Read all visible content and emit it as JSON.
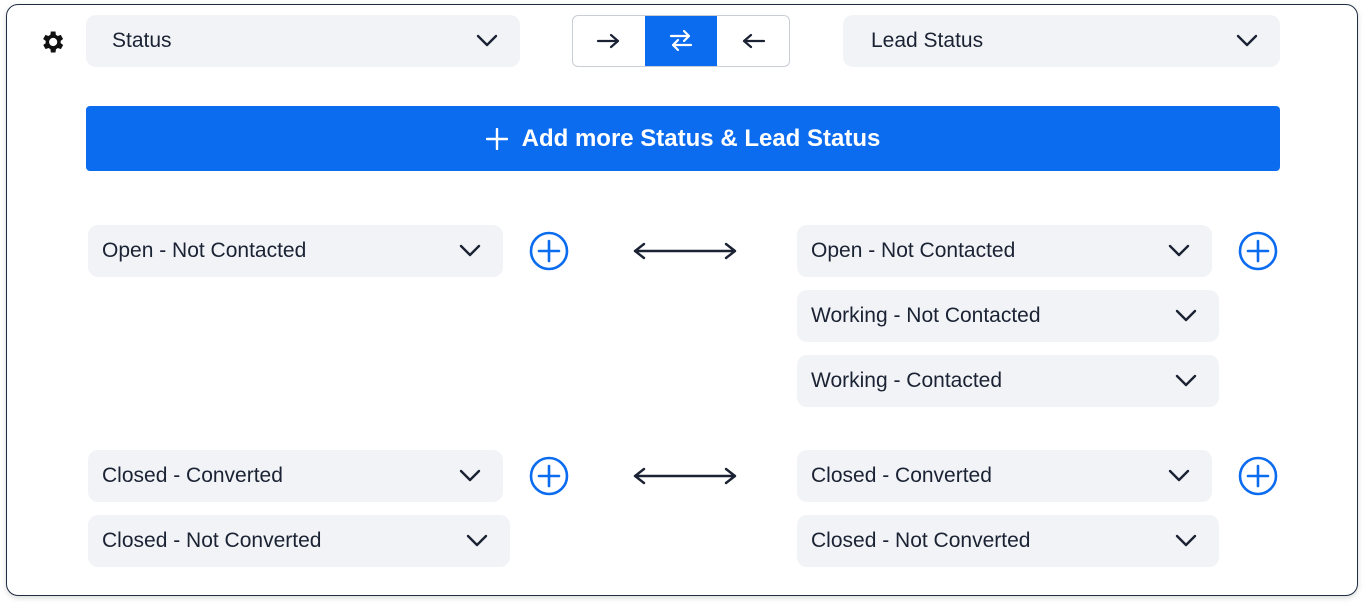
{
  "header": {
    "left_field": "Status",
    "right_field": "Lead Status",
    "direction_options": [
      "right-arrow-icon",
      "sync-arrows-icon",
      "left-arrow-icon"
    ],
    "active_direction": "sync"
  },
  "add_button": {
    "label": "Add more Status & Lead Status"
  },
  "mappings": [
    {
      "left": [
        "Open - Not Contacted"
      ],
      "right": [
        "Open - Not Contacted",
        "Working - Not Contacted",
        "Working - Contacted"
      ]
    },
    {
      "left": [
        "Closed - Converted",
        "Closed - Not Converted"
      ],
      "right": [
        "Closed - Converted",
        "Closed - Not Converted"
      ]
    }
  ],
  "colors": {
    "accent": "#0b6cf0",
    "field_bg": "#f1f3f6",
    "text": "#1a2233"
  }
}
